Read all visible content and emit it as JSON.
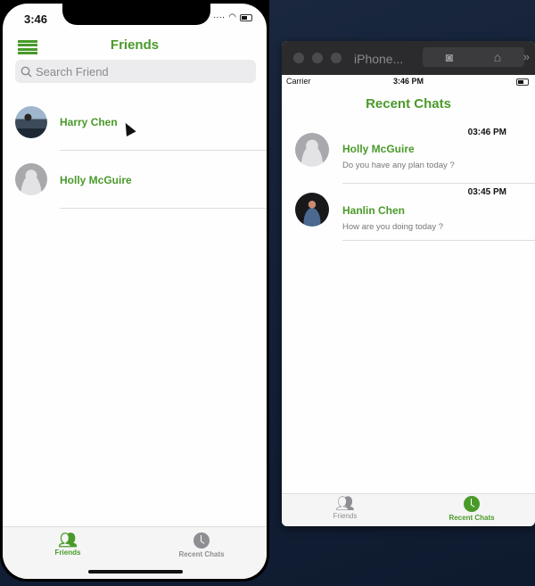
{
  "phone": {
    "status_time": "3:46",
    "title": "Friends",
    "search": {
      "placeholder": "Search Friend",
      "value": ""
    },
    "friends": [
      {
        "name": "Harry Chen",
        "avatar": "photo"
      },
      {
        "name": "Holly McGuire",
        "avatar": "placeholder"
      }
    ],
    "tabs": [
      {
        "label": "Friends",
        "icon": "people-icon",
        "active": true
      },
      {
        "label": "Recent Chats",
        "icon": "clock-icon",
        "active": false
      }
    ]
  },
  "simulator": {
    "window_title": "iPhone...",
    "carrier": "Carrier",
    "status_time": "3:46 PM",
    "title": "Recent Chats",
    "chats": [
      {
        "name": "Holly McGuire",
        "time": "03:46 PM",
        "message": "Do you have any plan today ?",
        "avatar": "placeholder"
      },
      {
        "name": "Hanlin Chen",
        "time": "03:45 PM",
        "message": "How are you doing today ?",
        "avatar": "photo"
      }
    ],
    "tabs": [
      {
        "label": "Friends",
        "icon": "people-icon",
        "active": false
      },
      {
        "label": "Recent Chats",
        "icon": "clock-icon",
        "active": true
      }
    ]
  },
  "colors": {
    "accent": "#4a9a2a",
    "inactive": "#8e8e93"
  }
}
